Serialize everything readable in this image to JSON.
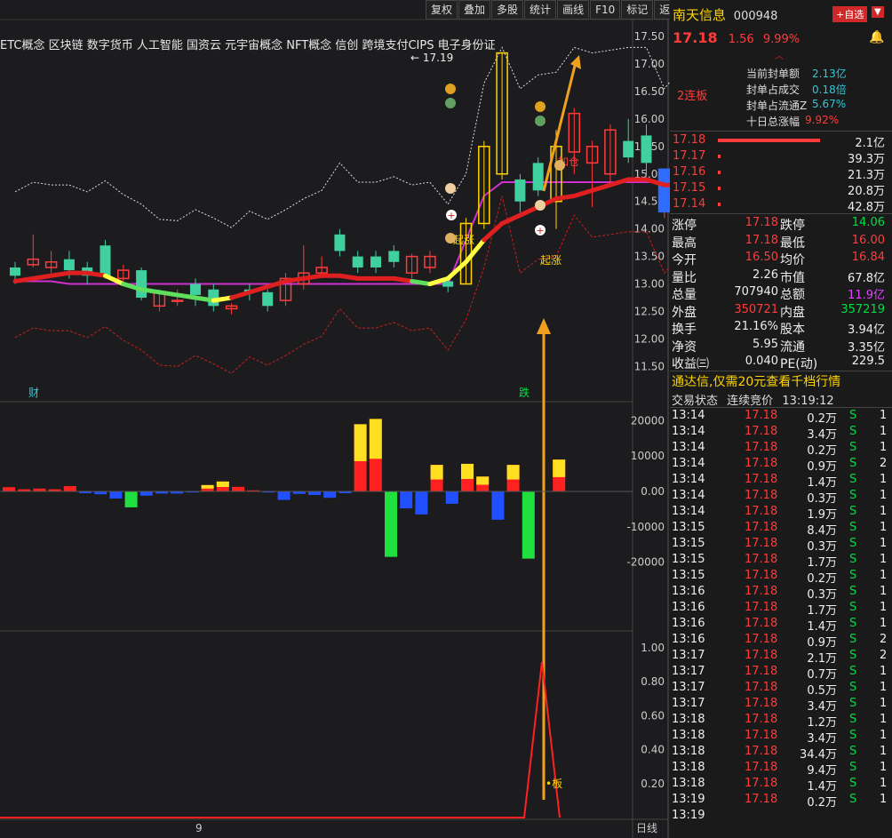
{
  "toolbar": {
    "buttons": [
      "复权",
      "叠加",
      "多股",
      "统计",
      "画线",
      "F10",
      "标记",
      "返回"
    ]
  },
  "concepts": "ETC概念 区块链 数字货币 人工智能 国资云 元宇宙概念 NFT概念 信创 跨境支付CIPS 电子身份证",
  "chart": {
    "peak_label": "17.19",
    "price_axis": [
      "17.50",
      "17.00",
      "16.50",
      "16.00",
      "15.50",
      "15.00",
      "14.50",
      "14.00",
      "13.50",
      "13.00",
      "12.50",
      "12.00",
      "11.50"
    ],
    "vol_axis": [
      "20000",
      "10000",
      "0.00",
      "-10000",
      "-20000"
    ],
    "ind_axis": [
      "1.00",
      "0.80",
      "0.60",
      "0.40",
      "0.20"
    ],
    "labels": {
      "start1": "起涨",
      "start2": "起涨",
      "add": "加仓",
      "cai": "财",
      "die": "跌",
      "ban": "板",
      "nine": "9",
      "dayline": "日线",
      "lianban": "2连板"
    },
    "candles": [
      {
        "o": 13.3,
        "c": 13.15,
        "h": 13.4,
        "l": 13.0
      },
      {
        "o": 13.35,
        "c": 13.45,
        "h": 13.9,
        "l": 13.3
      },
      {
        "o": 13.3,
        "c": 13.4,
        "h": 13.6,
        "l": 13.2
      },
      {
        "o": 13.45,
        "c": 13.25,
        "h": 13.6,
        "l": 13.1
      },
      {
        "o": 13.3,
        "c": 13.15,
        "h": 13.4,
        "l": 13.0
      },
      {
        "o": 13.7,
        "c": 13.15,
        "h": 13.8,
        "l": 13.1
      },
      {
        "o": 13.1,
        "c": 13.25,
        "h": 13.35,
        "l": 13.05
      },
      {
        "o": 13.25,
        "c": 12.75,
        "h": 13.3,
        "l": 12.7
      },
      {
        "o": 12.6,
        "c": 12.85,
        "h": 12.9,
        "l": 12.5
      },
      {
        "o": 12.7,
        "c": 12.7,
        "h": 12.9,
        "l": 12.6
      },
      {
        "o": 13.0,
        "c": 12.8,
        "h": 13.1,
        "l": 12.6
      },
      {
        "o": 12.9,
        "c": 12.6,
        "h": 13.0,
        "l": 12.5
      },
      {
        "o": 12.55,
        "c": 12.6,
        "h": 12.65,
        "l": 12.45
      },
      {
        "o": 12.9,
        "c": 12.85,
        "h": 13.0,
        "l": 12.7
      },
      {
        "o": 12.85,
        "c": 12.6,
        "h": 12.9,
        "l": 12.5
      },
      {
        "o": 12.7,
        "c": 13.1,
        "h": 13.2,
        "l": 12.6
      },
      {
        "o": 13.0,
        "c": 13.2,
        "h": 13.7,
        "l": 12.9
      },
      {
        "o": 13.2,
        "c": 13.3,
        "h": 13.5,
        "l": 13.15
      },
      {
        "o": 13.9,
        "c": 13.6,
        "h": 14.0,
        "l": 13.5
      },
      {
        "o": 13.5,
        "c": 13.3,
        "h": 13.6,
        "l": 13.2
      },
      {
        "o": 13.5,
        "c": 13.3,
        "h": 13.6,
        "l": 13.2
      },
      {
        "o": 13.6,
        "c": 13.4,
        "h": 13.7,
        "l": 13.3
      },
      {
        "o": 13.2,
        "c": 13.5,
        "h": 13.55,
        "l": 13.1
      },
      {
        "o": 13.3,
        "c": 13.5,
        "h": 13.6,
        "l": 13.2
      },
      {
        "o": 13.05,
        "c": 12.95,
        "h": 13.1,
        "l": 12.85
      },
      {
        "o": 13.0,
        "c": 14.1,
        "h": 14.2,
        "l": 13.0
      },
      {
        "o": 14.1,
        "c": 15.5,
        "h": 15.6,
        "l": 14.0
      },
      {
        "o": 15.0,
        "c": 17.2,
        "h": 17.2,
        "l": 14.9
      },
      {
        "o": 14.9,
        "c": 14.5,
        "h": 15.0,
        "l": 14.3
      },
      {
        "o": 15.2,
        "c": 14.7,
        "h": 15.3,
        "l": 14.6
      },
      {
        "o": 14.5,
        "c": 15.5,
        "h": 15.8,
        "l": 14.0
      },
      {
        "o": 15.4,
        "c": 16.1,
        "h": 16.2,
        "l": 15.0
      },
      {
        "o": 15.2,
        "c": 15.5,
        "h": 15.6,
        "l": 14.4
      },
      {
        "o": 15.0,
        "c": 15.8,
        "h": 15.9,
        "l": 14.8
      },
      {
        "o": 15.6,
        "c": 15.3,
        "h": 16.0,
        "l": 15.2
      },
      {
        "o": 15.7,
        "c": 15.2,
        "h": 15.9,
        "l": 15.0
      },
      {
        "o": 14.3,
        "c": 15.1,
        "h": 15.1,
        "l": 14.2
      },
      {
        "o": 14.6,
        "c": 15.6,
        "h": 15.6,
        "l": 14.5
      },
      {
        "o": 16.5,
        "c": 17.18,
        "h": 17.18,
        "l": 16.5
      }
    ]
  },
  "right": {
    "name": "南天信息",
    "code": "000948",
    "btn_add": "+自选",
    "price": "17.18",
    "chg": "1.56",
    "pct": "9.99%",
    "lianban": "2连板",
    "seal": [
      {
        "label": "当前封单额",
        "value": "2.13亿"
      },
      {
        "label": "封单占成交",
        "value": "0.18倍"
      },
      {
        "label": "封单占流通Z",
        "value": "5.67%"
      },
      {
        "label": "十日总涨幅",
        "value": "9.92%"
      }
    ],
    "bids": [
      {
        "p": "17.18",
        "v": "2.1亿"
      },
      {
        "p": "17.17",
        "v": "39.3万"
      },
      {
        "p": "17.16",
        "v": "21.3万"
      },
      {
        "p": "17.15",
        "v": "20.8万"
      },
      {
        "p": "17.14",
        "v": "42.8万"
      }
    ],
    "stats": [
      {
        "l1": "涨停",
        "v1": "17.18",
        "l2": "跌停",
        "v2": "14.06"
      },
      {
        "l1": "最高",
        "v1": "17.18",
        "l2": "最低",
        "v2": "16.00"
      },
      {
        "l1": "今开",
        "v1": "16.50",
        "l2": "均价",
        "v2": "16.84"
      },
      {
        "l1": "量比",
        "v1": "2.26",
        "l2": "市值",
        "v2": "67.8亿"
      },
      {
        "l1": "总量",
        "v1": "707940",
        "l2": "总额",
        "v2": "11.9亿"
      },
      {
        "l1": "外盘",
        "v1": "350721",
        "l2": "内盘",
        "v2": "357219"
      },
      {
        "l1": "换手",
        "v1": "21.16%",
        "l2": "股本",
        "v2": "3.94亿"
      },
      {
        "l1": "净资",
        "v1": "5.95",
        "l2": "流通",
        "v2": "3.35亿"
      },
      {
        "l1": "收益㈢",
        "v1": "0.040",
        "l2": "PE(动)",
        "v2": "229.5"
      }
    ],
    "ad": "通达信,仅需20元查看千档行情",
    "status_label": "交易状态",
    "status_value": "连续竞价",
    "status_time": "13:19:12",
    "ticks": [
      {
        "t": "13:14",
        "p": "17.18",
        "v": "0.2万",
        "s": "S",
        "n": "1"
      },
      {
        "t": "13:14",
        "p": "17.18",
        "v": "3.4万",
        "s": "S",
        "n": "1"
      },
      {
        "t": "13:14",
        "p": "17.18",
        "v": "0.2万",
        "s": "S",
        "n": "1"
      },
      {
        "t": "13:14",
        "p": "17.18",
        "v": "0.9万",
        "s": "S",
        "n": "2"
      },
      {
        "t": "13:14",
        "p": "17.18",
        "v": "1.4万",
        "s": "S",
        "n": "1"
      },
      {
        "t": "13:14",
        "p": "17.18",
        "v": "0.3万",
        "s": "S",
        "n": "1"
      },
      {
        "t": "13:14",
        "p": "17.18",
        "v": "1.9万",
        "s": "S",
        "n": "1"
      },
      {
        "t": "13:15",
        "p": "17.18",
        "v": "8.4万",
        "s": "S",
        "n": "1"
      },
      {
        "t": "13:15",
        "p": "17.18",
        "v": "0.3万",
        "s": "S",
        "n": "1"
      },
      {
        "t": "13:15",
        "p": "17.18",
        "v": "1.7万",
        "s": "S",
        "n": "1"
      },
      {
        "t": "13:15",
        "p": "17.18",
        "v": "0.2万",
        "s": "S",
        "n": "1"
      },
      {
        "t": "13:16",
        "p": "17.18",
        "v": "0.3万",
        "s": "S",
        "n": "1"
      },
      {
        "t": "13:16",
        "p": "17.18",
        "v": "1.7万",
        "s": "S",
        "n": "1"
      },
      {
        "t": "13:16",
        "p": "17.18",
        "v": "1.4万",
        "s": "S",
        "n": "1"
      },
      {
        "t": "13:16",
        "p": "17.18",
        "v": "0.9万",
        "s": "S",
        "n": "2"
      },
      {
        "t": "13:17",
        "p": "17.18",
        "v": "2.1万",
        "s": "S",
        "n": "2"
      },
      {
        "t": "13:17",
        "p": "17.18",
        "v": "0.7万",
        "s": "S",
        "n": "1"
      },
      {
        "t": "13:17",
        "p": "17.18",
        "v": "0.5万",
        "s": "S",
        "n": "1"
      },
      {
        "t": "13:17",
        "p": "17.18",
        "v": "3.4万",
        "s": "S",
        "n": "1"
      },
      {
        "t": "13:18",
        "p": "17.18",
        "v": "1.2万",
        "s": "S",
        "n": "1"
      },
      {
        "t": "13:18",
        "p": "17.18",
        "v": "3.4万",
        "s": "S",
        "n": "1"
      },
      {
        "t": "13:18",
        "p": "17.18",
        "v": "34.4万",
        "s": "S",
        "n": "1"
      },
      {
        "t": "13:18",
        "p": "17.18",
        "v": "9.4万",
        "s": "S",
        "n": "1"
      },
      {
        "t": "13:18",
        "p": "17.18",
        "v": "1.4万",
        "s": "S",
        "n": "1"
      },
      {
        "t": "13:19",
        "p": "17.18",
        "v": "0.2万",
        "s": "S",
        "n": "1"
      },
      {
        "t": "13:19",
        "p": "",
        "v": "",
        "s": "",
        "n": ""
      }
    ],
    "colors": {
      "up": "#ff3b3b",
      "down": "#00dd44",
      "accent": "#ffd400"
    }
  }
}
